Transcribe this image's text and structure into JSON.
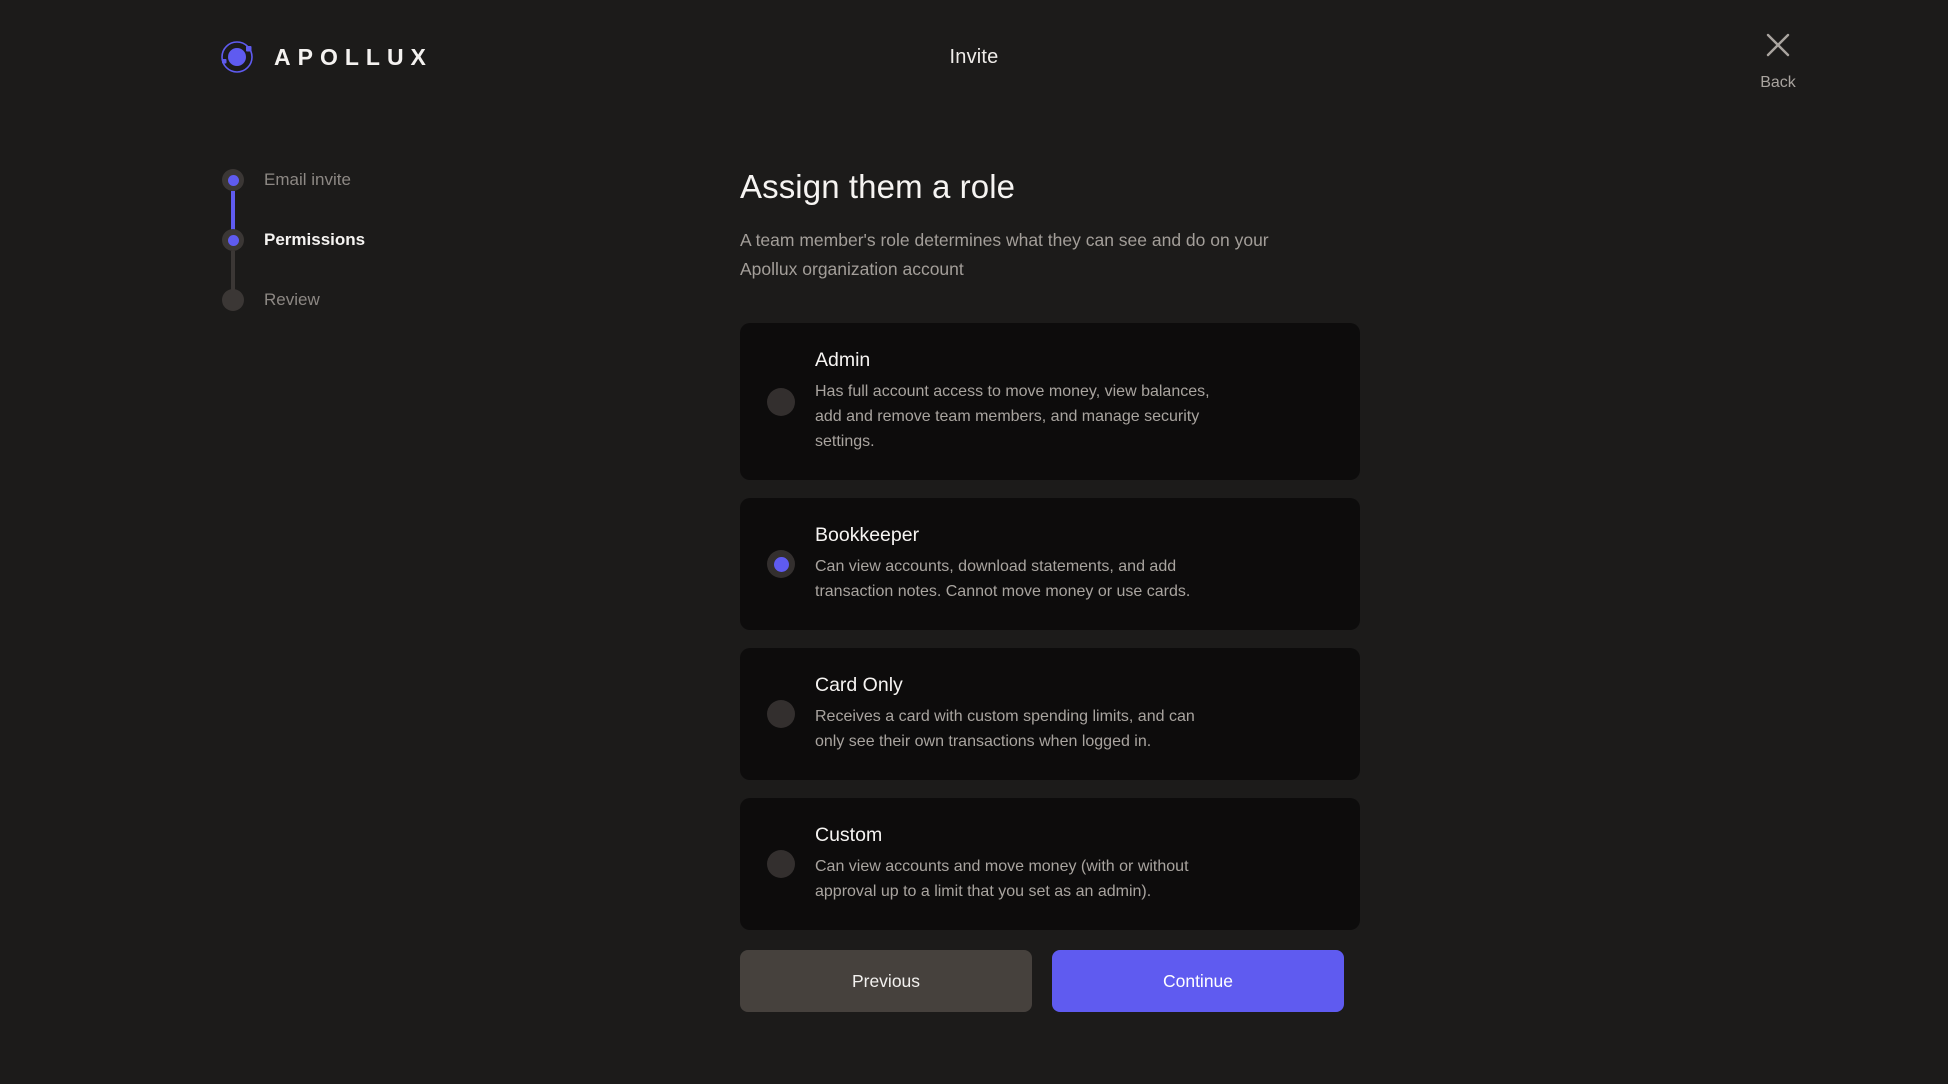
{
  "brand": {
    "name": "APOLLUX",
    "logo_icon": "planet-orbit-icon",
    "accent_color": "#5f5bf0"
  },
  "header": {
    "title": "Invite",
    "back": {
      "label": "Back",
      "icon": "close-x-icon"
    }
  },
  "stepper": {
    "steps": [
      {
        "label": "Email invite",
        "state": "done"
      },
      {
        "label": "Permissions",
        "state": "active"
      },
      {
        "label": "Review",
        "state": "pending"
      }
    ]
  },
  "main": {
    "title": "Assign them a role",
    "subtitle": "A team member's role determines what they can see and do on your Apollux organization account",
    "roles": [
      {
        "name": "Admin",
        "description": "Has full account access to move money, view balances, add and remove team members, and manage security settings.",
        "selected": false
      },
      {
        "name": "Bookkeeper",
        "description": "Can view accounts, download statements, and add transaction notes. Cannot move money or use cards.",
        "selected": true
      },
      {
        "name": "Card Only",
        "description": "Receives a card with custom spending limits, and can only see their own transactions when logged in.",
        "selected": false
      },
      {
        "name": "Custom",
        "description": "Can view accounts and move money (with or without approval up to a limit that you set as an admin).",
        "selected": false
      }
    ],
    "actions": {
      "previous_label": "Previous",
      "continue_label": "Continue"
    }
  },
  "colors": {
    "page_background": "#1c1b1a",
    "card_background": "#0d0c0c",
    "accent": "#5f5bf0",
    "secondary_button": "#46413d",
    "muted_text": "#a9a49f"
  }
}
